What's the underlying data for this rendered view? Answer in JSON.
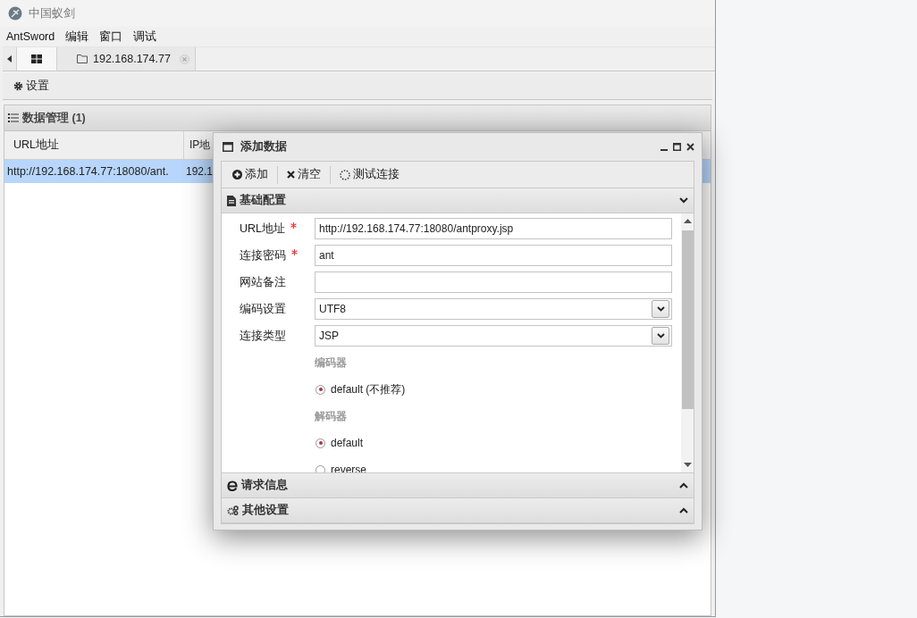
{
  "window": {
    "title": "中国蚁剑"
  },
  "menu": [
    "AntSword",
    "编辑",
    "窗口",
    "调试"
  ],
  "tabs": [
    {
      "kind": "home",
      "selected": true
    },
    {
      "kind": "folder",
      "label": "192.168.174.77",
      "selected": false
    }
  ],
  "toolbar": [
    "设置"
  ],
  "panel": {
    "title": "数据管理 (1)"
  },
  "table": {
    "columns": [
      "URL地址",
      "IP地"
    ],
    "rows": [
      {
        "cells": [
          "http://192.168.174.77:18080/ant.",
          "192.1"
        ],
        "selected": true
      }
    ]
  },
  "dialog": {
    "title": "添加数据",
    "toolbar": [
      {
        "kind": "add",
        "label": "添加"
      },
      {
        "kind": "clear",
        "label": "清空"
      },
      {
        "kind": "test",
        "label": "测试连接"
      }
    ],
    "sections": [
      {
        "kind": "doc",
        "title": "基础配置",
        "expanded": true
      },
      {
        "kind": "request",
        "title": "请求信息",
        "expanded": false
      },
      {
        "kind": "gears",
        "title": "其他设置",
        "expanded": false
      }
    ],
    "fields": [
      {
        "kind": "text",
        "label": "URL地址",
        "required": true,
        "value": "http://192.168.174.77:18080/antproxy.jsp"
      },
      {
        "kind": "text",
        "label": "连接密码",
        "required": true,
        "value": "ant"
      },
      {
        "kind": "text",
        "label": "网站备注",
        "required": false
      },
      {
        "kind": "select",
        "label": "编码设置",
        "required": false,
        "value": "UTF8"
      },
      {
        "kind": "select",
        "label": "连接类型",
        "required": false,
        "value": "JSP"
      }
    ],
    "groups": [
      {
        "title": "编码器",
        "options": [
          {
            "label": "default (不推荐)",
            "selected": true
          }
        ]
      },
      {
        "title": "解码器",
        "options": [
          {
            "label": "default",
            "selected": true
          },
          {
            "label": "reverse",
            "selected": false
          }
        ]
      }
    ]
  }
}
